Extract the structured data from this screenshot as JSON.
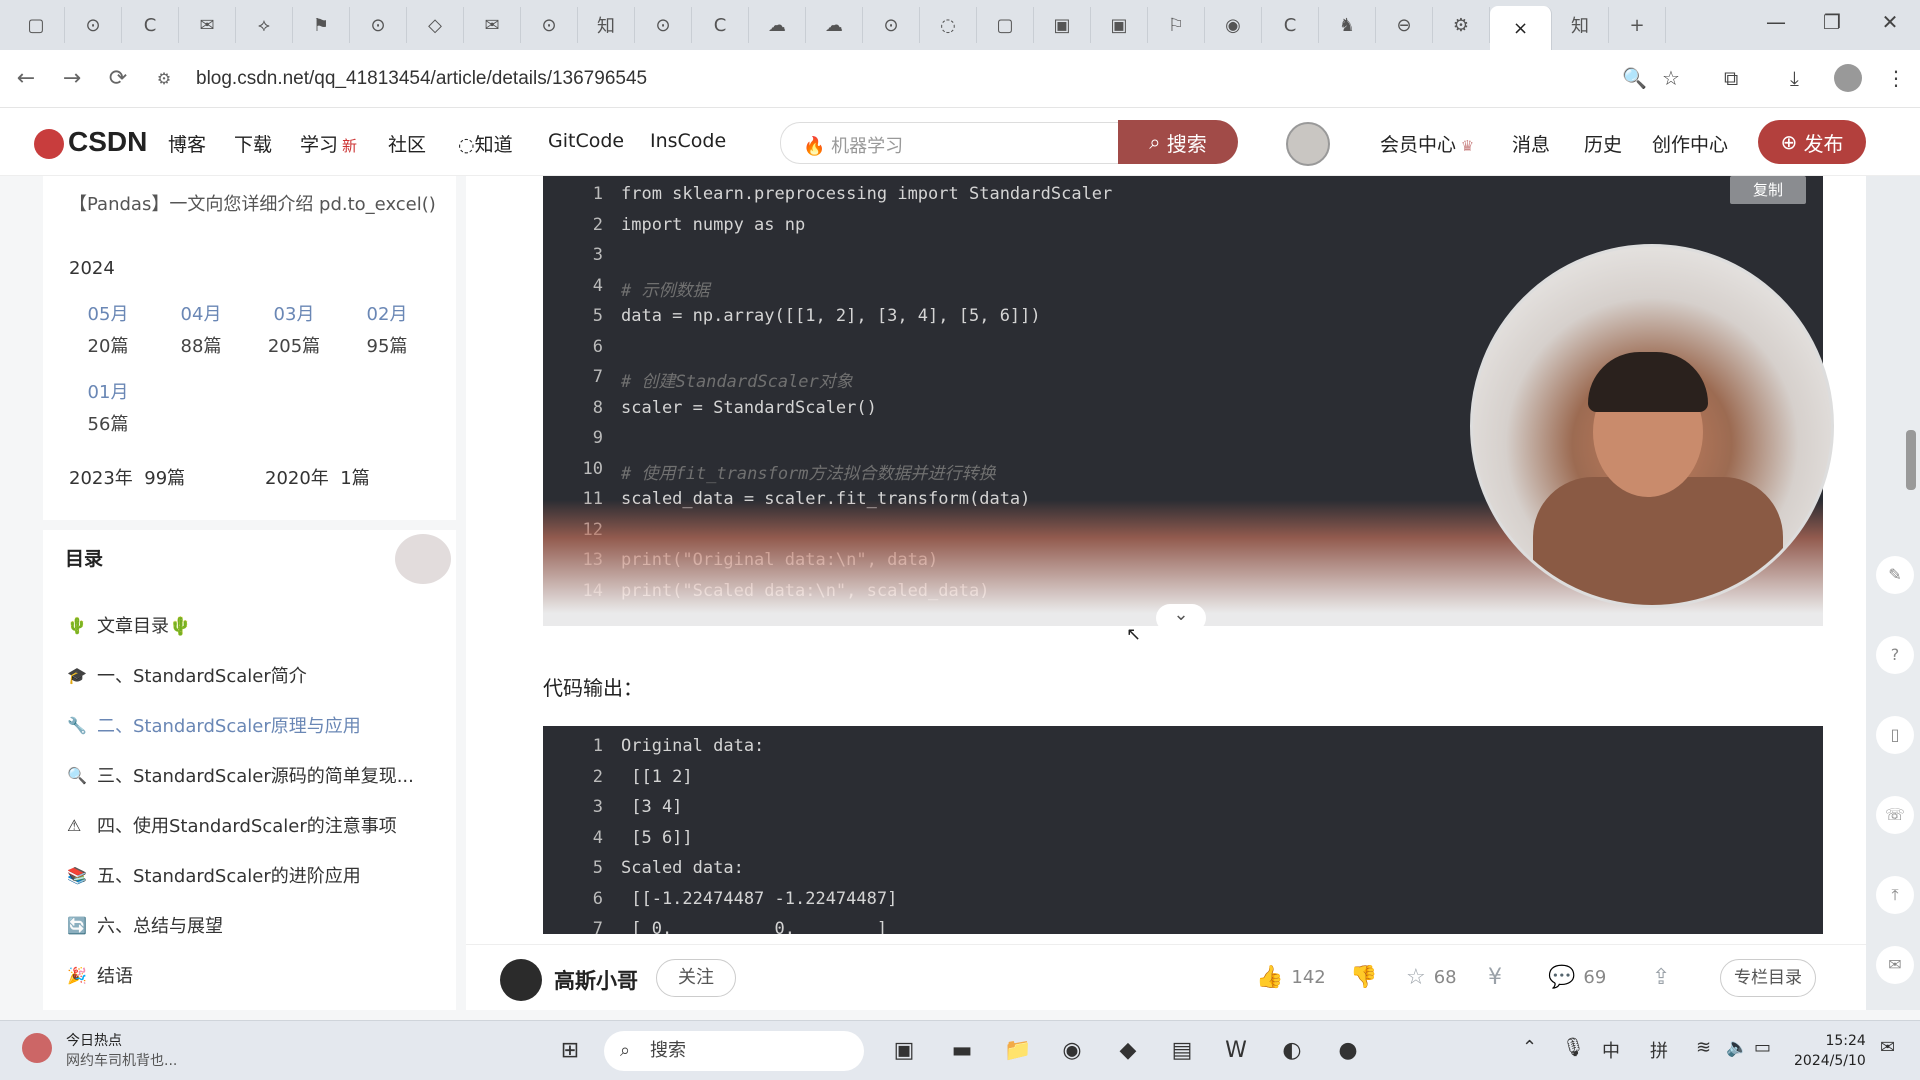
{
  "browser": {
    "tabs": [
      "▢",
      "⊙",
      "C",
      "✉",
      "⟡",
      "⚑",
      "⊙",
      "◇",
      "✉",
      "⊙",
      "知",
      "⊙",
      "C",
      "☁",
      "☁",
      "⊙",
      "◌",
      "▢",
      "▣",
      "▣",
      "⚐",
      "◉",
      "C",
      "♞",
      "⊖",
      "⚙",
      "×",
      "知",
      "+"
    ],
    "url": "blog.csdn.net/qq_41813454/article/details/136796545",
    "window_controls": [
      "—",
      "❐",
      "✕"
    ]
  },
  "site_nav": {
    "logo": "CSDN",
    "items": [
      "博客",
      "下载",
      "学习",
      "社区",
      "知道",
      "GitCode",
      "InsCode"
    ],
    "new_badge": "新",
    "search_placeholder": "机器学习",
    "search_button": "搜索",
    "right_items": [
      "会员中心",
      "消息",
      "历史",
      "创作中心"
    ],
    "publish": "发布"
  },
  "archive": {
    "prev_article": "【Pandas】一文向您详细介绍 pd.to_excel()",
    "year": "2024",
    "months": [
      {
        "m": "05月",
        "c": "20篇"
      },
      {
        "m": "04月",
        "c": "88篇"
      },
      {
        "m": "03月",
        "c": "205篇"
      },
      {
        "m": "02月",
        "c": "95篇"
      },
      {
        "m": "01月",
        "c": "56篇"
      }
    ],
    "year_2023": "2023年",
    "count_2023": "99篇",
    "year_2020": "2020年",
    "count_2020": "1篇"
  },
  "toc": {
    "title": "目录",
    "items": [
      {
        "icon": "🌵",
        "label": "文章目录🌵"
      },
      {
        "icon": "🎓",
        "label": "一、StandardScaler简介"
      },
      {
        "icon": "🔧",
        "label": "二、StandardScaler原理与应用"
      },
      {
        "icon": "🔍",
        "label": "三、StandardScaler源码的简单复现..."
      },
      {
        "icon": "⚠",
        "label": "四、使用StandardScaler的注意事项"
      },
      {
        "icon": "📚",
        "label": "五、StandardScaler的进阶应用"
      },
      {
        "icon": "🔄",
        "label": "六、总结与展望"
      },
      {
        "icon": "🎉",
        "label": "结语"
      }
    ]
  },
  "code1": {
    "copy": "复制",
    "lines": [
      "from sklearn.preprocessing import StandardScaler",
      "import numpy as np",
      "",
      "# 示例数据",
      "data = np.array([[1, 2], [3, 4], [5, 6]])",
      "",
      "# 创建StandardScaler对象",
      "scaler = StandardScaler()",
      "",
      "# 使用fit_transform方法拟合数据并进行转换",
      "scaled_data = scaler.fit_transform(data)",
      "",
      "print(\"Original data:\\n\", data)",
      "print(\"Scaled data:\\n\", scaled_data)"
    ]
  },
  "output_label": "代码输出：",
  "code2": {
    "lines": [
      "Original data:",
      " [[1 2]",
      " [3 4]",
      " [5 6]]",
      "Scaled data:",
      " [[-1.22474487 -1.22474487]",
      " [ 0.          0.        ]"
    ]
  },
  "footer": {
    "author": "高斯小哥",
    "follow": "关注",
    "likes": "142",
    "stars": "68",
    "comments": "69",
    "column": "专栏目录"
  },
  "taskbar": {
    "news_title": "今日热点",
    "news_sub": "网约车司机背也...",
    "search": "搜索",
    "time": "15:24",
    "date": "2024/5/10",
    "ime1": "中",
    "ime2": "拼"
  }
}
